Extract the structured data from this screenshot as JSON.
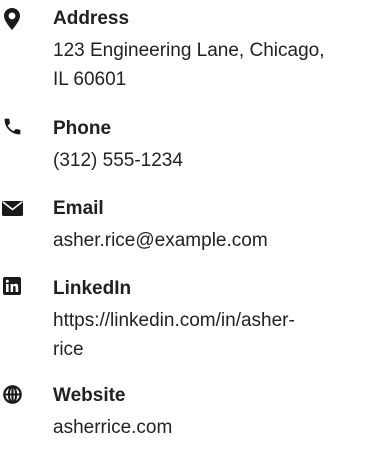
{
  "contacts": {
    "address": {
      "icon": "map-pin-icon",
      "label": "Address",
      "line1": "123 Engineering Lane, Chicago,",
      "line2": "IL 60601"
    },
    "phone": {
      "icon": "phone-icon",
      "label": "Phone",
      "value": "(312) 555-1234"
    },
    "email": {
      "icon": "envelope-icon",
      "label": "Email",
      "value": "asher.rice@example.com"
    },
    "linkedin": {
      "icon": "linkedin-icon",
      "label": "LinkedIn",
      "line1": "https://linkedin.com/in/asher-",
      "line2": "rice"
    },
    "website": {
      "icon": "globe-icon",
      "label": "Website",
      "value": "asherrice.com"
    }
  }
}
